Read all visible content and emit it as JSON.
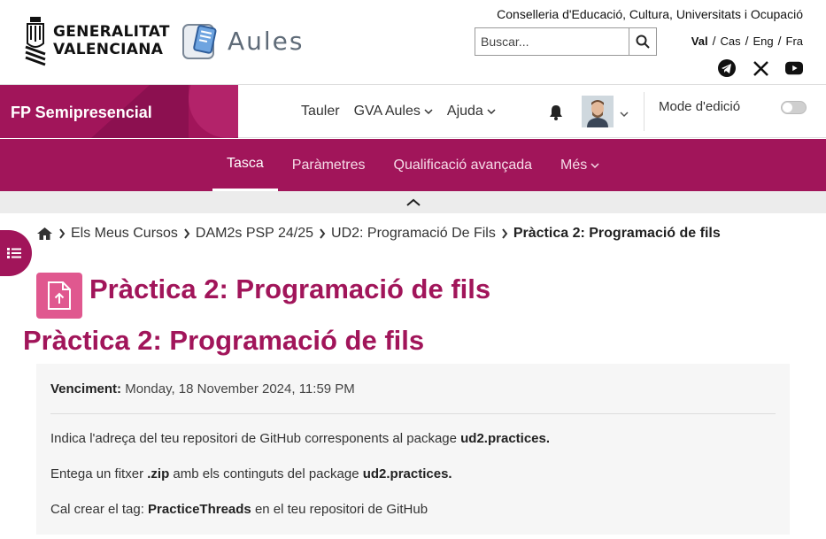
{
  "header": {
    "gva_line1": "GENERALITAT",
    "gva_line2": "VALENCIANA",
    "aules_name": "Aules",
    "conselleria": "Conselleria d'Educació, Cultura, Universitats i Ocupació",
    "search_placeholder": "Buscar...",
    "languages": [
      {
        "label": "Val",
        "active": true
      },
      {
        "label": "Cas",
        "active": false
      },
      {
        "label": "Eng",
        "active": false
      },
      {
        "label": "Fra",
        "active": false
      }
    ],
    "social_icons": [
      "telegram-icon",
      "x-icon",
      "youtube-icon"
    ]
  },
  "navbar": {
    "brand": "FP Semipresencial",
    "items": [
      {
        "label": "Tauler",
        "dropdown": false
      },
      {
        "label": "GVA Aules",
        "dropdown": true
      },
      {
        "label": "Ajuda",
        "dropdown": true
      }
    ],
    "edit_mode_label": "Mode d'edició",
    "edit_mode_on": false
  },
  "secondary_nav": {
    "tabs": [
      {
        "label": "Tasca",
        "active": true,
        "dropdown": false
      },
      {
        "label": "Paràmetres",
        "active": false,
        "dropdown": false
      },
      {
        "label": "Qualificació avançada",
        "active": false,
        "dropdown": false
      },
      {
        "label": "Més",
        "active": false,
        "dropdown": true
      }
    ]
  },
  "breadcrumb": {
    "items": [
      "Els Meus Cursos",
      "DAM2s PSP 24/25",
      "UD2: Programació De Fils"
    ],
    "current": "Pràctica 2: Programació de fils"
  },
  "page": {
    "title": "Pràctica 2: Programació de fils",
    "activity_title": "Pràctica 2: Programació de fils"
  },
  "assignment": {
    "due_label": "Venciment:",
    "due_value": "Monday, 18 November 2024, 11:59 PM",
    "p1_text": "Indica l'adreça del teu repositori de GitHub corresponents al package ",
    "p1_bold": "ud2.practices.",
    "p2_text_a": "Entega un fitxer ",
    "p2_bold_a": ".zip",
    "p2_text_b": " amb els continguts del package ",
    "p2_bold_b": "ud2.practices.",
    "p3_text_a": "Cal crear el tag: ",
    "p3_bold": "PracticeThreads",
    "p3_text_b": " en el teu repositori de GitHub"
  },
  "colors": {
    "brand": "#a1155a",
    "module_icon": "#e0588f"
  }
}
